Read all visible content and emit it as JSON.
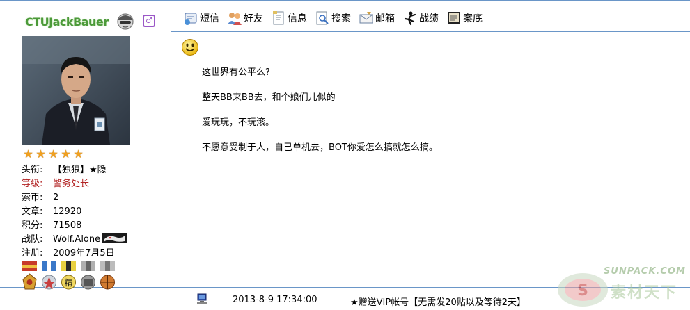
{
  "profile": {
    "username": "CTUJackBauer",
    "gender_symbol": "♂",
    "stars": [
      "★",
      "★",
      "★",
      "★",
      "★"
    ],
    "rows": [
      {
        "label": "头衔:",
        "value": "【独狼】★隐"
      },
      {
        "label": "等级:",
        "value": "警务处长"
      },
      {
        "label": "索币:",
        "value": "2"
      },
      {
        "label": "文章:",
        "value": "12920"
      },
      {
        "label": "积分:",
        "value": "71508"
      },
      {
        "label": "战队:",
        "value": "Wolf.Alone"
      },
      {
        "label": "注册:",
        "value": "2009年7月5日"
      }
    ],
    "medal_glyph": "精"
  },
  "toolbar": {
    "items": [
      {
        "label": "短信",
        "icon": "message-icon"
      },
      {
        "label": "好友",
        "icon": "friends-icon"
      },
      {
        "label": "信息",
        "icon": "info-icon"
      },
      {
        "label": "搜索",
        "icon": "search-icon"
      },
      {
        "label": "邮箱",
        "icon": "mail-icon"
      },
      {
        "label": "战绩",
        "icon": "record-icon"
      },
      {
        "label": "案底",
        "icon": "archive-icon"
      }
    ]
  },
  "post": {
    "lines": [
      "这世界有公平么?",
      "整天BB来BB去，和个娘们儿似的",
      "爱玩玩，不玩滚。",
      "不愿意受制于人，自己单机去，BOT你爱怎么搞就怎么搞。"
    ]
  },
  "footer": {
    "timestamp": "2013-8-9 17:34:00",
    "signature": "★赠送VIP帐号【无需发20贴以及等待2天】"
  },
  "watermark": {
    "line1": "SUNPACK.COM",
    "line2": "素材天下"
  },
  "colors": {
    "border": "#6a96c8",
    "username": "#4c9a3a",
    "rank": "#b22222"
  }
}
